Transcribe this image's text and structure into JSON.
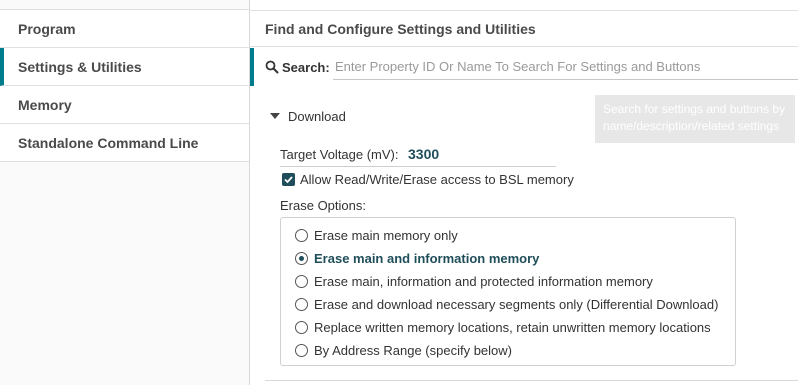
{
  "sidebar": {
    "items": [
      {
        "label": "Program",
        "active": false
      },
      {
        "label": "Settings & Utilities",
        "active": true
      },
      {
        "label": "Memory",
        "active": false
      },
      {
        "label": "Standalone Command Line",
        "active": false
      }
    ]
  },
  "main": {
    "title": "Find and Configure Settings and Utilities",
    "search": {
      "label": "Search:",
      "placeholder": "Enter Property ID Or Name To Search For Settings and Buttons",
      "value": "",
      "icon": "search-icon"
    },
    "tooltip": "Search for settings and buttons by name/description/related settings",
    "section": {
      "title": "Download",
      "expanded": true,
      "target_voltage_label": "Target Voltage (mV):",
      "target_voltage_value": "3300",
      "bsl_access_label": "Allow Read/Write/Erase access to BSL memory",
      "bsl_access_checked": true,
      "erase_options_label": "Erase Options:",
      "erase_options": [
        {
          "label": "Erase main memory only",
          "selected": false
        },
        {
          "label": "Erase main and information memory",
          "selected": true
        },
        {
          "label": "Erase main, information and protected information memory",
          "selected": false
        },
        {
          "label": "Erase and download necessary segments only (Differential Download)",
          "selected": false
        },
        {
          "label": "Replace written memory locations, retain unwritten memory locations",
          "selected": false
        },
        {
          "label": "By Address Range (specify below)",
          "selected": false
        }
      ]
    }
  },
  "colors": {
    "accent": "#007c8c",
    "selected_text": "#1f4e5a"
  }
}
